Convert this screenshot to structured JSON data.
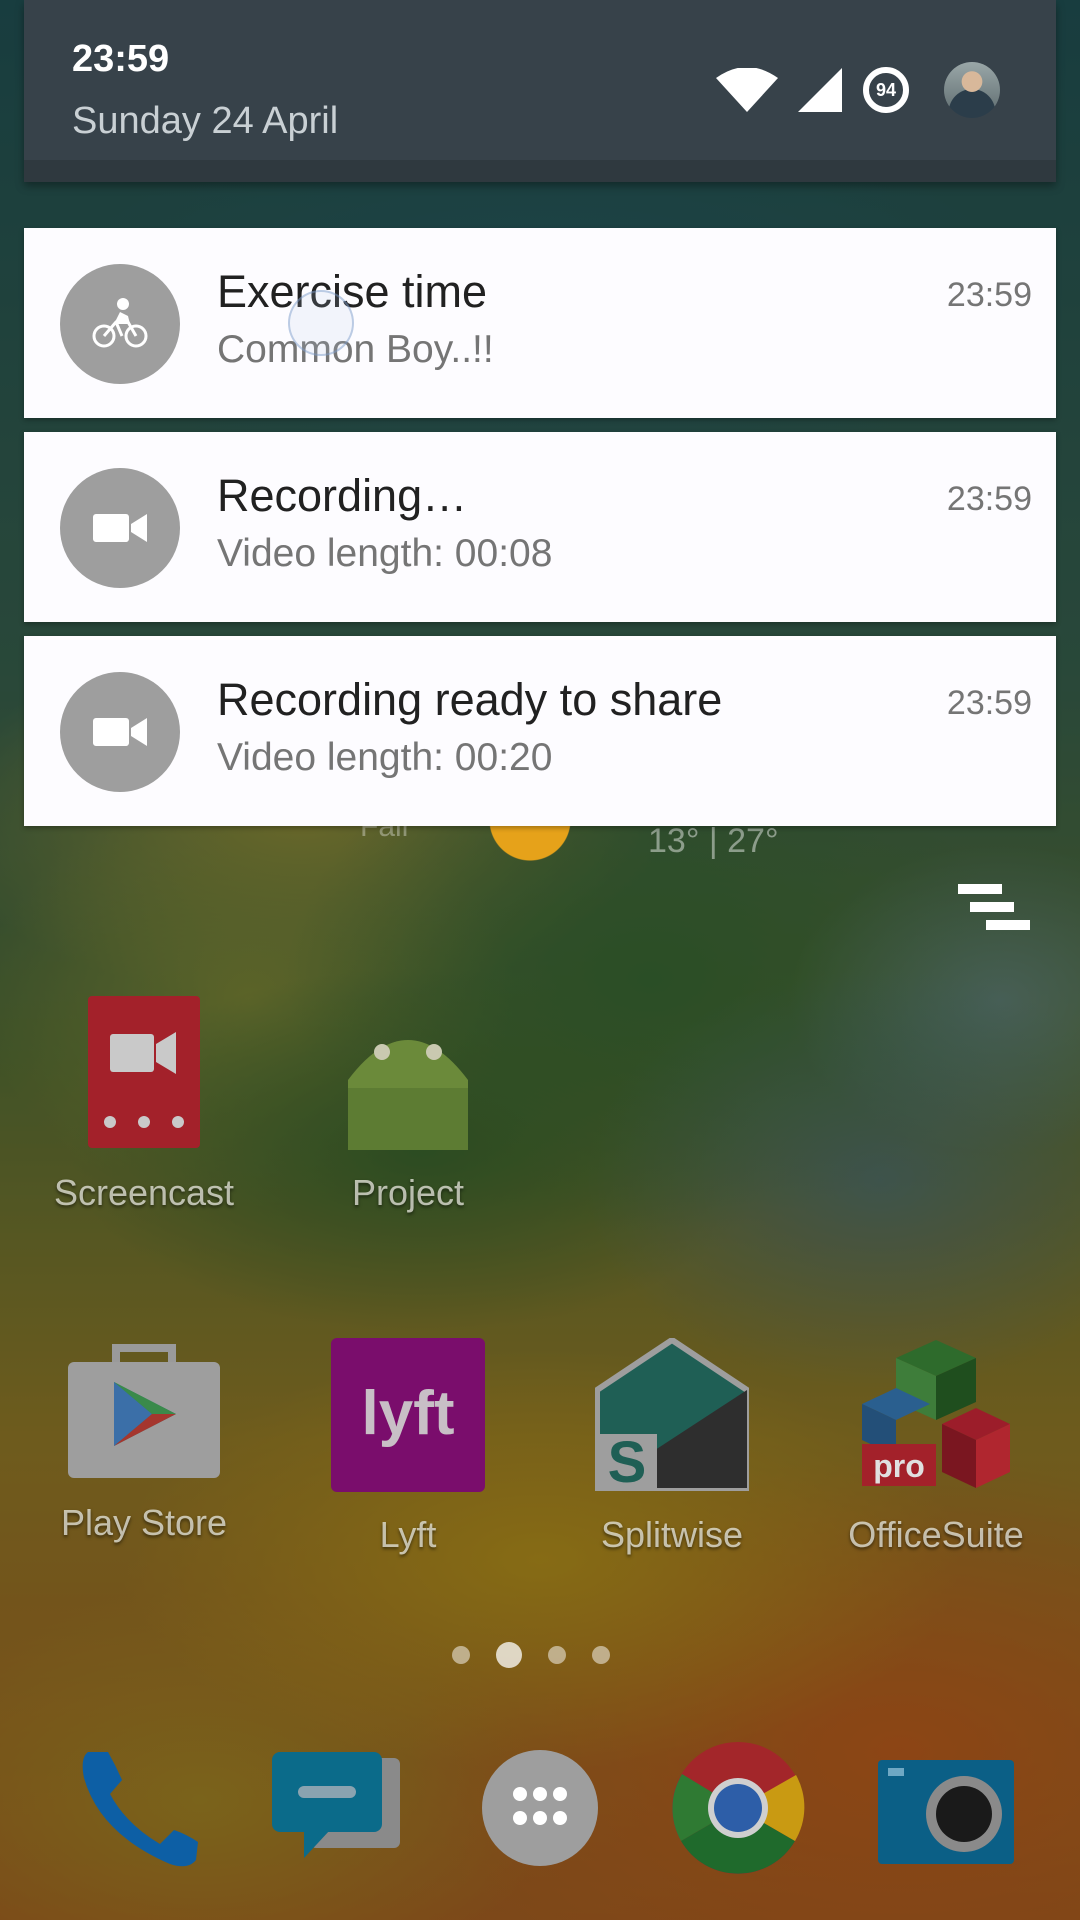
{
  "status_bar": {
    "time": "23:59",
    "date": "Sunday 24 April",
    "battery_level": "94",
    "icons": [
      "wifi-icon",
      "cell-signal-icon",
      "battery-icon",
      "avatar"
    ]
  },
  "notifications": [
    {
      "icon": "bicycle-icon",
      "title": "Exercise time",
      "text": "Common Boy..!!",
      "time": "23:59"
    },
    {
      "icon": "video-camera-icon",
      "title": "Recording…",
      "text": "Video length: 00:08",
      "time": "23:59"
    },
    {
      "icon": "video-camera-icon",
      "title": "Recording ready to share",
      "text": "Video length: 00:20",
      "time": "23:59"
    }
  ],
  "weather": {
    "temperature_range": "13° | 27°",
    "condition_partial": "Fair"
  },
  "home": {
    "row1": [
      {
        "label": "Screencast",
        "icon": "screencast-icon"
      },
      {
        "label": "Project",
        "icon": "android-icon"
      }
    ],
    "row2": [
      {
        "label": "Play Store",
        "icon": "play-store-icon"
      },
      {
        "label": "Lyft",
        "icon": "lyft-icon",
        "icon_text": "lyft"
      },
      {
        "label": "Splitwise",
        "icon": "splitwise-icon",
        "icon_text": "S"
      },
      {
        "label": "OfficeSuite",
        "icon": "officesuite-icon",
        "icon_text": "pro"
      }
    ],
    "page_indicator": {
      "pages": 4,
      "current": 2
    },
    "dock": [
      "phone-icon",
      "messages-icon",
      "app-drawer-icon",
      "chrome-icon",
      "camera-icon"
    ]
  },
  "colors": {
    "header_bg": "#37424a",
    "card_bg": "#fdfcff",
    "icon_circle": "#9e9e9e",
    "screencast": "#c62828",
    "lyft": "#8a0b7a"
  }
}
